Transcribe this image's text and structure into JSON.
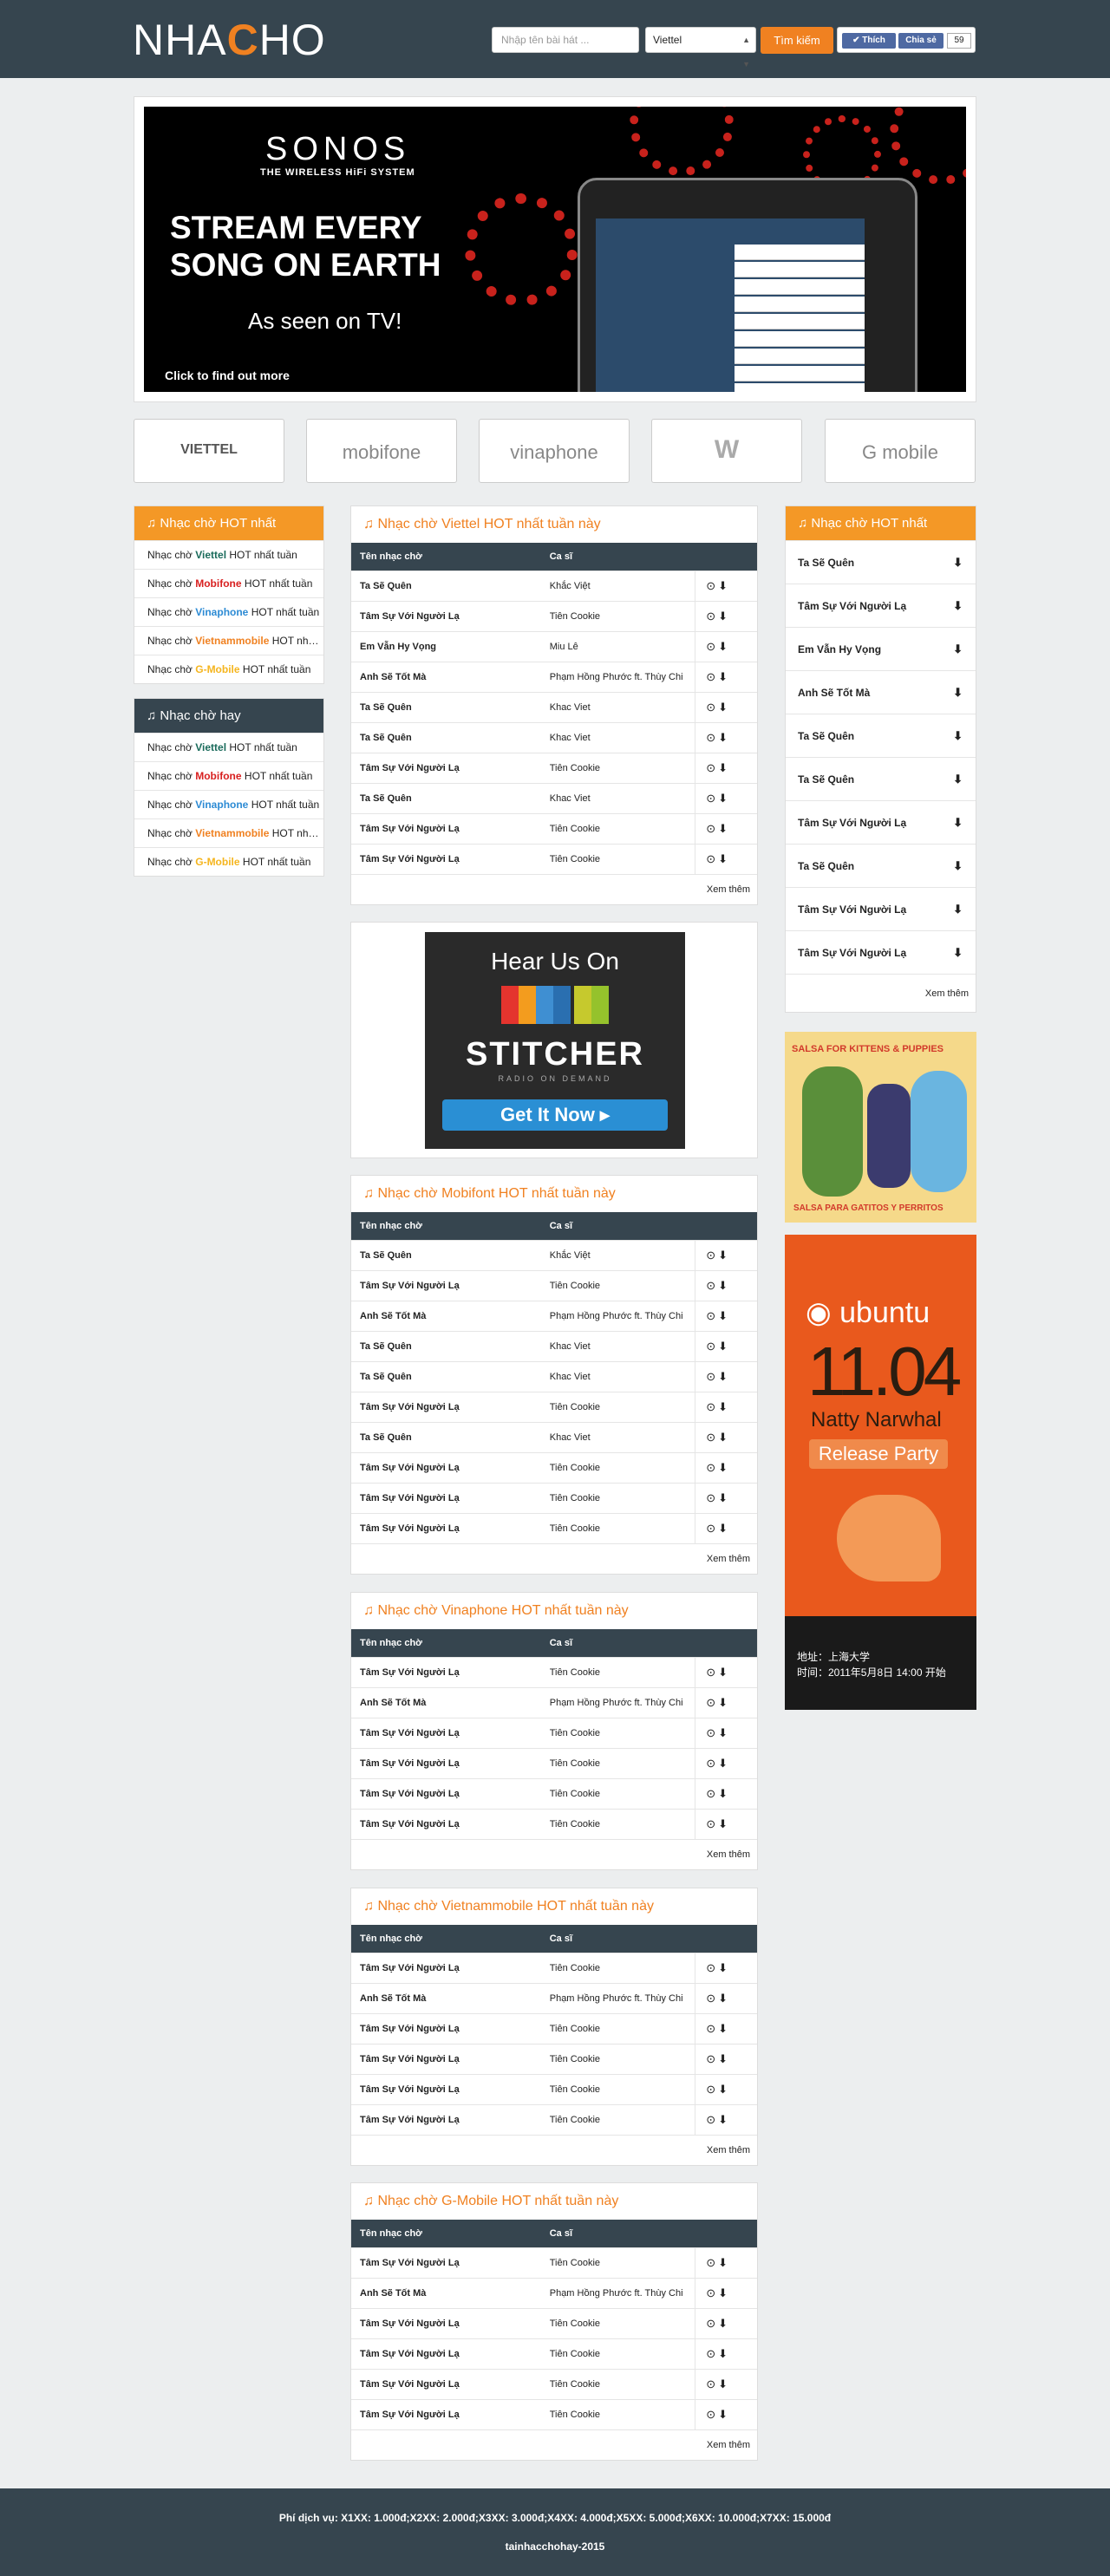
{
  "header": {
    "logo_a": "NHA",
    "logo_c": "C",
    "logo_b": "HO",
    "search_placeholder": "Nhập tên bài hát ...",
    "carrier_selected": "Viettel",
    "search_button": "Tìm kiếm",
    "like_label": "Thích",
    "share_label": "Chia sẻ",
    "share_count": "59"
  },
  "banner": {
    "brand": "SONOS",
    "tagline": "THE WIRELESS HiFi SYSTEM",
    "headline_1": "STREAM EVERY",
    "headline_2": "SONG ON EARTH",
    "seen": "As seen on TV!",
    "cta": "Click to find out more"
  },
  "carriers": [
    "VIETTEL",
    "mobifone",
    "vinaphone",
    "Vietnamobile",
    "G mobile"
  ],
  "left_hot": {
    "title": "Nhạc chờ HOT nhất",
    "items": [
      {
        "pre": "Nhạc chờ ",
        "carrier": "Viettel",
        "post": " HOT nhất tuần",
        "cls": "c-vt"
      },
      {
        "pre": "Nhạc chờ ",
        "carrier": "Mobifone",
        "post": " HOT nhất tuần",
        "cls": "c-mb"
      },
      {
        "pre": "Nhạc chờ ",
        "carrier": "Vinaphone",
        "post": " HOT nhất tuần",
        "cls": "c-vn"
      },
      {
        "pre": "Nhạc chờ ",
        "carrier": "Vietnammobile",
        "post": " HOT nhất tuần",
        "cls": "c-vm"
      },
      {
        "pre": "Nhạc chờ ",
        "carrier": "G-Mobile",
        "post": " HOT nhất tuần",
        "cls": "c-gm"
      }
    ]
  },
  "left_good": {
    "title": "Nhạc chờ hay",
    "items": [
      {
        "pre": "Nhạc chờ ",
        "carrier": "Viettel",
        "post": " HOT nhất tuần",
        "cls": "c-vt"
      },
      {
        "pre": "Nhạc chờ ",
        "carrier": "Mobifone",
        "post": " HOT nhất tuần",
        "cls": "c-mb"
      },
      {
        "pre": "Nhạc chờ ",
        "carrier": "Vinaphone",
        "post": " HOT nhất tuần",
        "cls": "c-vn"
      },
      {
        "pre": "Nhạc chờ ",
        "carrier": "Vietnammobile",
        "post": " HOT nhất tuần",
        "cls": "c-vm"
      },
      {
        "pre": "Nhạc chờ ",
        "carrier": "G-Mobile",
        "post": " HOT nhất tuần",
        "cls": "c-gm"
      }
    ]
  },
  "table_headers": {
    "name": "Tên nhạc chờ",
    "singer": "Ca sĩ"
  },
  "more_label": "Xem thêm",
  "sections": [
    {
      "title": "Nhạc chờ Viettel HOT nhất tuần này",
      "rows": [
        [
          "Ta Sẽ Quên",
          "Khắc Việt"
        ],
        [
          "Tâm Sự Với Người Lạ",
          "Tiên Cookie"
        ],
        [
          "Em Vẫn Hy Vọng",
          "Miu Lê"
        ],
        [
          "Anh Sẽ Tốt Mà",
          "Phạm Hồng Phước ft. Thùy Chi"
        ],
        [
          "Ta Sẽ Quên",
          "Khac Viet"
        ],
        [
          "Ta Sẽ Quên",
          "Khac Viet"
        ],
        [
          "Tâm Sự Với Người Lạ",
          "Tiên Cookie"
        ],
        [
          "Ta Sẽ Quên",
          "Khac Viet"
        ],
        [
          "Tâm Sự Với Người Lạ",
          "Tiên Cookie"
        ],
        [
          "Tâm Sự Với Người Lạ",
          "Tiên Cookie"
        ]
      ]
    },
    {
      "title": "Nhạc chờ Mobifont HOT nhất tuần này",
      "rows": [
        [
          "Ta Sẽ Quên",
          "Khắc Việt"
        ],
        [
          "Tâm Sự Với Người Lạ",
          "Tiên Cookie"
        ],
        [
          "Anh Sẽ Tốt Mà",
          "Phạm Hồng Phước ft. Thùy Chi"
        ],
        [
          "Ta Sẽ Quên",
          "Khac Viet"
        ],
        [
          "Ta Sẽ Quên",
          "Khac Viet"
        ],
        [
          "Tâm Sự Với Người Lạ",
          "Tiên Cookie"
        ],
        [
          "Ta Sẽ Quên",
          "Khac Viet"
        ],
        [
          "Tâm Sự Với Người Lạ",
          "Tiên Cookie"
        ],
        [
          "Tâm Sự Với Người Lạ",
          "Tiên Cookie"
        ],
        [
          "Tâm Sự Với Người Lạ",
          "Tiên Cookie"
        ]
      ]
    },
    {
      "title": "Nhạc chờ Vinaphone HOT nhất tuần này",
      "rows": [
        [
          "Tâm Sự Với Người Lạ",
          "Tiên Cookie"
        ],
        [
          "Anh Sẽ Tốt Mà",
          "Phạm Hồng Phước ft. Thùy Chi"
        ],
        [
          "Tâm Sự Với Người Lạ",
          "Tiên Cookie"
        ],
        [
          "Tâm Sự Với Người Lạ",
          "Tiên Cookie"
        ],
        [
          "Tâm Sự Với Người Lạ",
          "Tiên Cookie"
        ],
        [
          "Tâm Sự Với Người Lạ",
          "Tiên Cookie"
        ]
      ]
    },
    {
      "title": "Nhạc chờ Vietnammobile HOT nhất tuần này",
      "rows": [
        [
          "Tâm Sự Với Người Lạ",
          "Tiên Cookie"
        ],
        [
          "Anh Sẽ Tốt Mà",
          "Phạm Hồng Phước ft. Thùy Chi"
        ],
        [
          "Tâm Sự Với Người Lạ",
          "Tiên Cookie"
        ],
        [
          "Tâm Sự Với Người Lạ",
          "Tiên Cookie"
        ],
        [
          "Tâm Sự Với Người Lạ",
          "Tiên Cookie"
        ],
        [
          "Tâm Sự Với Người Lạ",
          "Tiên Cookie"
        ]
      ]
    },
    {
      "title": "Nhạc chờ G-Mobile HOT nhất tuần này",
      "rows": [
        [
          "Tâm Sự Với Người Lạ",
          "Tiên Cookie"
        ],
        [
          "Anh Sẽ Tốt Mà",
          "Phạm Hồng Phước ft. Thùy Chi"
        ],
        [
          "Tâm Sự Với Người Lạ",
          "Tiên Cookie"
        ],
        [
          "Tâm Sự Với Người Lạ",
          "Tiên Cookie"
        ],
        [
          "Tâm Sự Với Người Lạ",
          "Tiên Cookie"
        ],
        [
          "Tâm Sự Với Người Lạ",
          "Tiên Cookie"
        ]
      ]
    }
  ],
  "right_hot": {
    "title": "Nhạc chờ HOT nhất",
    "items": [
      "Ta Sẽ Quên",
      "Tâm Sự Với Người Lạ",
      "Em Vẫn Hy Vọng",
      "Anh Sẽ Tốt Mà",
      "Ta Sẽ Quên",
      "Ta Sẽ Quên",
      "Tâm Sự Với Người Lạ",
      "Ta Sẽ Quên",
      "Tâm Sự Với Người Lạ",
      "Tâm Sự Với Người Lạ"
    ]
  },
  "stitcher": {
    "hear": "Hear Us On",
    "brand": "STITCHER",
    "radio": "RADIO ON DEMAND",
    "cta": "Get It Now ▸"
  },
  "salsa": {
    "top": "SALSA FOR KITTENS & PUPPIES",
    "bottom": "SALSA PARA GATITOS Y PERRITOS"
  },
  "ubuntu": {
    "brand": "ubuntu",
    "version": "11.04",
    "name": "Natty Narwhal",
    "party": "Release Party",
    "addr": "地址：上海大学",
    "time": "时间：2011年5月8日 14:00 开始"
  },
  "footer": {
    "fees": "Phí dịch vụ: X1XX: 1.000đ;X2XX: 2.000đ;X3XX: 3.000đ;X4XX: 4.000đ;X5XX: 5.000đ;X6XX: 10.000đ;X7XX: 15.000đ",
    "site": "tainhacchohay-2015"
  },
  "colors": {
    "accent": "#f08121",
    "dark": "#36454f"
  }
}
